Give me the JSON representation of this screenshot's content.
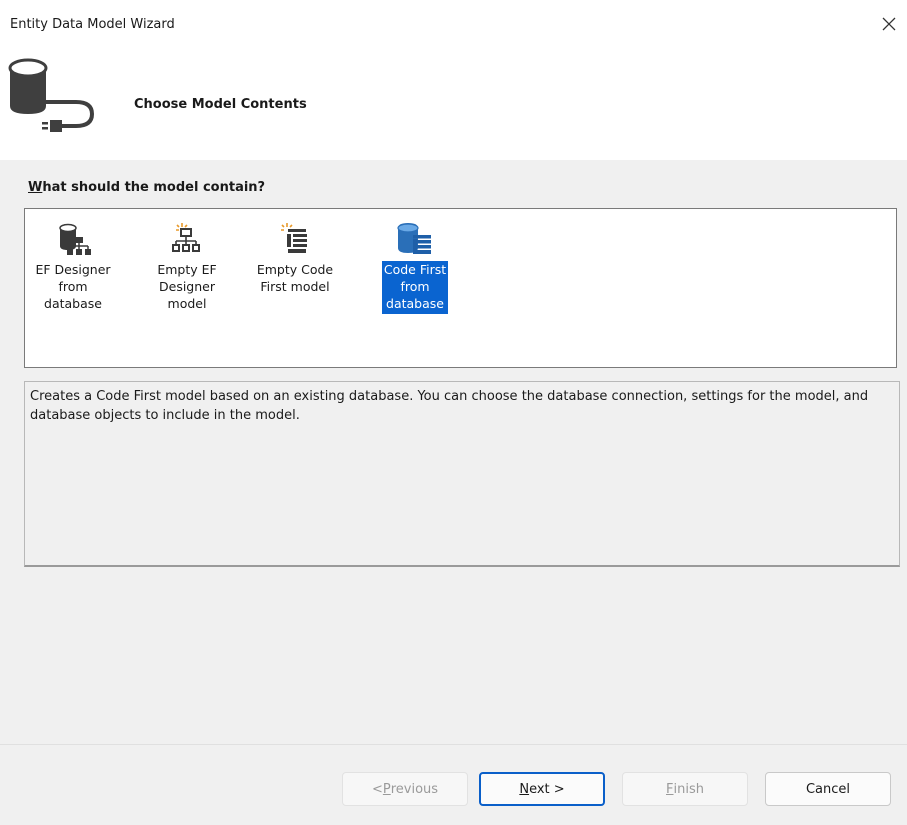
{
  "window": {
    "title": "Entity Data Model Wizard"
  },
  "header": {
    "title": "Choose Model Contents"
  },
  "question": {
    "accesskey": "W",
    "rest": "hat should the model contain?"
  },
  "models": [
    {
      "line1": "EF Designer",
      "line2": "from",
      "line3": "database",
      "icon": "db-designer-icon",
      "selected": false
    },
    {
      "line1": "Empty EF",
      "line2": "Designer",
      "line3": "model",
      "icon": "empty-designer-icon",
      "selected": false
    },
    {
      "line1": "Empty Code",
      "line2": "First model",
      "line3": "",
      "icon": "empty-code-first-icon",
      "selected": false
    },
    {
      "line1": "Code First",
      "line2": "from",
      "line3": "database",
      "icon": "code-first-db-icon",
      "selected": true
    }
  ],
  "description": "Creates a Code First model based on an existing database. You can choose the database connection, settings for the model, and database objects to include in the model.",
  "buttons": {
    "previous": {
      "prefix": "< ",
      "accesskey": "P",
      "rest": "revious"
    },
    "next": {
      "accesskey": "N",
      "rest": "ext >"
    },
    "finish": {
      "accesskey": "F",
      "rest": "inish"
    },
    "cancel": {
      "label": "Cancel"
    }
  },
  "colors": {
    "selection": "#0a64d0",
    "default_button_border": "#0a5fc9"
  }
}
